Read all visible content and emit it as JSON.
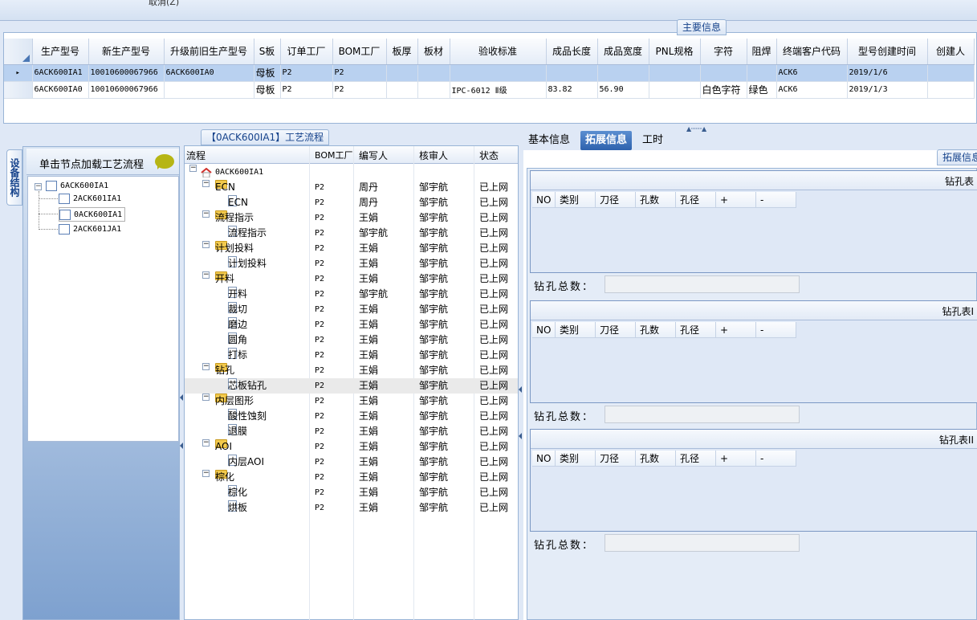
{
  "topbar": {
    "cancel_label": "取消(Z)"
  },
  "main_info": {
    "tab_title": "主要信息",
    "columns": [
      "生产型号",
      "新生产型号",
      "升级前旧生产型号",
      "S板",
      "订单工厂",
      "BOM工厂",
      "板厚",
      "板材",
      "验收标准",
      "成品长度",
      "成品宽度",
      "PNL规格",
      "字符",
      "阻焊",
      "终端客户代码",
      "型号创建时间",
      "创建人"
    ],
    "rows": [
      [
        "6ACK600IA1",
        "10010600067966",
        "6ACK600IA0",
        "母板",
        "P2",
        "P2",
        "",
        "",
        "",
        "",
        "",
        "",
        "",
        "",
        "ACK6",
        "2019/1/6",
        ""
      ],
      [
        "6ACK600IA0",
        "10010600067966",
        "",
        "母板",
        "P2",
        "P2",
        "",
        "",
        "IPC-6012 Ⅱ级",
        "83.82",
        "56.90",
        "",
        "白色字符",
        "绿色",
        "ACK6",
        "2019/1/3",
        ""
      ]
    ]
  },
  "left_panel": {
    "vertical_tab": "设备结构",
    "hint": "单击节点加载工艺流程",
    "tree_root": "6ACK600IA1",
    "tree_children": [
      "2ACK601IA1",
      "0ACK600IA1",
      "2ACK601JA1"
    ]
  },
  "process": {
    "tab_title": "【0ACK600IA1】工艺流程",
    "columns": {
      "flow": "流程",
      "bom": "BOM工厂",
      "author": "编写人",
      "reviewer": "核审人",
      "status": "状态"
    },
    "root": "0ACK600IA1",
    "rows": [
      {
        "name": "ECN",
        "bom": "P2",
        "author": "周丹",
        "reviewer": "邹宇航",
        "status": "已上网"
      },
      {
        "name": "ECN",
        "bom": "P2",
        "author": "周丹",
        "reviewer": "邹宇航",
        "status": "已上网"
      },
      {
        "name": "流程指示",
        "bom": "P2",
        "author": "王娟",
        "reviewer": "邹宇航",
        "status": "已上网"
      },
      {
        "name": "流程指示",
        "bom": "P2",
        "author": "邹宇航",
        "reviewer": "邹宇航",
        "status": "已上网"
      },
      {
        "name": "计划投料",
        "bom": "P2",
        "author": "王娟",
        "reviewer": "邹宇航",
        "status": "已上网"
      },
      {
        "name": "计划投料",
        "bom": "P2",
        "author": "王娟",
        "reviewer": "邹宇航",
        "status": "已上网"
      },
      {
        "name": "开料",
        "bom": "P2",
        "author": "王娟",
        "reviewer": "邹宇航",
        "status": "已上网"
      },
      {
        "name": "开料",
        "bom": "P2",
        "author": "邹宇航",
        "reviewer": "邹宇航",
        "status": "已上网"
      },
      {
        "name": "裁切",
        "bom": "P2",
        "author": "王娟",
        "reviewer": "邹宇航",
        "status": "已上网"
      },
      {
        "name": "磨边",
        "bom": "P2",
        "author": "王娟",
        "reviewer": "邹宇航",
        "status": "已上网"
      },
      {
        "name": "圆角",
        "bom": "P2",
        "author": "王娟",
        "reviewer": "邹宇航",
        "status": "已上网"
      },
      {
        "name": "打标",
        "bom": "P2",
        "author": "王娟",
        "reviewer": "邹宇航",
        "status": "已上网"
      },
      {
        "name": "钻孔",
        "bom": "P2",
        "author": "王娟",
        "reviewer": "邹宇航",
        "status": "已上网"
      },
      {
        "name": "芯板钻孔",
        "bom": "P2",
        "author": "王娟",
        "reviewer": "邹宇航",
        "status": "已上网"
      },
      {
        "name": "内层图形",
        "bom": "P2",
        "author": "王娟",
        "reviewer": "邹宇航",
        "status": "已上网"
      },
      {
        "name": "酸性蚀刻",
        "bom": "P2",
        "author": "王娟",
        "reviewer": "邹宇航",
        "status": "已上网"
      },
      {
        "name": "退膜",
        "bom": "P2",
        "author": "王娟",
        "reviewer": "邹宇航",
        "status": "已上网"
      },
      {
        "name": "AOI",
        "bom": "P2",
        "author": "王娟",
        "reviewer": "邹宇航",
        "status": "已上网"
      },
      {
        "name": "内层AOI",
        "bom": "P2",
        "author": "王娟",
        "reviewer": "邹宇航",
        "status": "已上网"
      },
      {
        "name": "棕化",
        "bom": "P2",
        "author": "王娟",
        "reviewer": "邹宇航",
        "status": "已上网"
      },
      {
        "name": "棕化",
        "bom": "P2",
        "author": "王娟",
        "reviewer": "邹宇航",
        "status": "已上网"
      },
      {
        "name": "烘板",
        "bom": "P2",
        "author": "王娟",
        "reviewer": "邹宇航",
        "status": "已上网"
      }
    ]
  },
  "right_panel": {
    "tabs": [
      "基本信息",
      "拓展信息",
      "工时"
    ],
    "section_title": "拓展信息",
    "drill_tables": [
      {
        "title": "钻孔表"
      },
      {
        "title": "钻孔表I"
      },
      {
        "title": "钻孔表II"
      }
    ],
    "drill_columns": [
      "NO",
      "类别",
      "刀径",
      "孔数",
      "孔径",
      "+",
      "-"
    ],
    "count_label": "钻孔总数："
  },
  "icons": {
    "tree_node": "document-icon",
    "group": "folder-icon",
    "root": "home-icon",
    "hint": "speech-bubble-icon"
  },
  "colors": {
    "accent": "#2e62ad",
    "selection": "#b9d1f0",
    "folder": "#f2c94c",
    "bubble": "#b6b514"
  }
}
